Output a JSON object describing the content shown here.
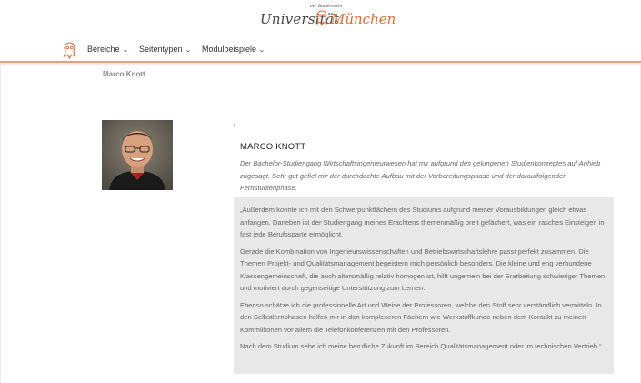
{
  "header": {
    "logo_small": "der Bundeswehr",
    "logo_uni": "Universität",
    "logo_city": "München",
    "brand_color": "#e06b2c"
  },
  "nav": {
    "items": [
      {
        "label": "Bereiche",
        "icon": "chevron-down-icon"
      },
      {
        "label": "Seitentypen",
        "icon": "chevron-down-icon"
      },
      {
        "label": "Modulbeispiele",
        "icon": "chevron-down-icon"
      }
    ],
    "chevron": "⌄"
  },
  "breadcrumb": "Marco Knott",
  "profile": {
    "name": "MARCO KNOTT",
    "intro": "Der Bachelor-Studiengang Wirtschaftsingenieurwesen hat mir aufgrund des gelungenen Studienkonzeptes auf Anhieb zugesagt. Sehr gut gefiel mir der durchdachte Aufbau mit der Vorbereitungsphase und der darauffolgenden Fernstudienphase.",
    "quote": [
      "„Außerdem konnte ich mit den Schwerpunktfächern des Studiums aufgrund meiner Vorausbildungen gleich etwas anfangen. Daneben ist der Studiengang meines Erachtens themenmäßig breit gefächert, was ein rasches Einsteigen in fast jede Berufssparte ermöglicht.",
      "Gerade die Kombination von Ingenieurswissenschaften und Betriebswirtschaftslehre passt perfekt zusammen. Die Themen Projekt- und Qualitätsmanagement begeistern mich persönlich besonders. Die kleine und eng verbundene Klassengemeinschaft, die auch altersmäßig relativ homogen ist, hilft ungemein bei der Erarbeitung schwieriger Themen und motiviert durch gegenseitige Unterstützung zum Lernen.",
      "Ebenso schätze ich die professionelle Art und Weise der Professoren, welche den Stoff sehr verständlich vermitteln. In den Selbstlernphasen helfen mir in den komplexeren Fächern wie Werkstoffkunde neben dem Kontakt zu meinen Kommilitonen vor allem die Telefonkonferenzen mit den Professoren.",
      "Nach dem Studium sehe ich meine berufliche Zukunft im Bereich Qualitätsmanagement oder im technischen Vertrieb.“"
    ]
  }
}
